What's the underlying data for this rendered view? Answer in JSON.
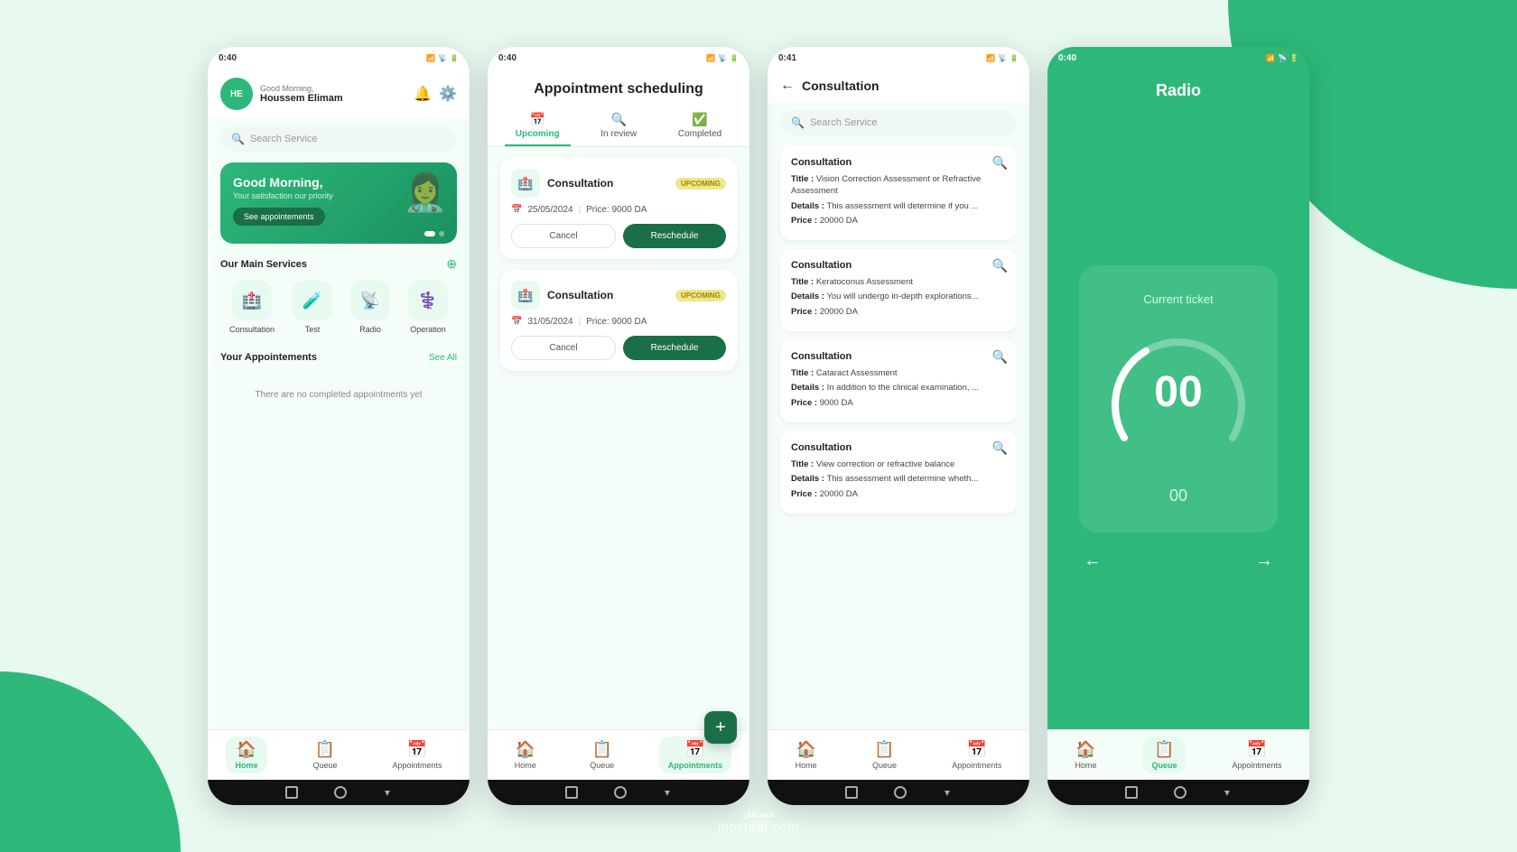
{
  "background": {
    "primary_color": "#e8f9f0",
    "accent_color": "#2db87a",
    "dark_accent": "#1a6e48"
  },
  "screen1": {
    "status_time": "0:40",
    "user_initials": "HE",
    "greeting_small": "Good Morning,",
    "user_name": "Houssem Elimam",
    "search_placeholder": "Search Service",
    "banner_title": "Good Morning,",
    "banner_subtitle": "Your satisfaction our priority",
    "banner_btn": "See appointements",
    "section_services": "Our Main Services",
    "section_appointments": "Your Appointements",
    "see_all": "See All",
    "no_appointments": "There are no completed appointments yet",
    "services": [
      {
        "label": "Consultation",
        "icon": "🏥"
      },
      {
        "label": "Test",
        "icon": "🧪"
      },
      {
        "label": "Radio",
        "icon": "📡"
      },
      {
        "label": "Operation",
        "icon": "⚕️"
      }
    ],
    "nav": [
      {
        "label": "Home",
        "icon": "🏠",
        "active": true
      },
      {
        "label": "Queue",
        "icon": "📋",
        "active": false
      },
      {
        "label": "Appointments",
        "icon": "📅",
        "active": false
      }
    ]
  },
  "screen2": {
    "status_time": "0:40",
    "title": "Appointment scheduling",
    "tabs": [
      {
        "label": "Upcoming",
        "icon": "📅",
        "active": true
      },
      {
        "label": "In review",
        "icon": "🔍",
        "active": false
      },
      {
        "label": "Completed",
        "icon": "✅",
        "active": false
      }
    ],
    "cards": [
      {
        "title": "Consultation",
        "badge": "UPCOMING",
        "date": "25/05/2024",
        "price": "Price: 9000 DA",
        "cancel_btn": "Cancel",
        "reschedule_btn": "Reschedule"
      },
      {
        "title": "Consultation",
        "badge": "UPCOMING",
        "date": "31/05/2024",
        "price": "Price: 9000 DA",
        "cancel_btn": "Cancel",
        "reschedule_btn": "Reschedule"
      }
    ],
    "fab_icon": "+",
    "nav": [
      {
        "label": "Home",
        "icon": "🏠",
        "active": false
      },
      {
        "label": "Queue",
        "icon": "📋",
        "active": false
      },
      {
        "label": "Appointments",
        "icon": "📅",
        "active": true
      }
    ]
  },
  "screen3": {
    "status_time": "0:41",
    "title": "Consultation",
    "search_placeholder": "Search Service",
    "cards": [
      {
        "title": "Consultation",
        "field_title_label": "Title :",
        "field_title_value": "Vision Correction Assessment or Refractive Assessment",
        "field_details_label": "Details :",
        "field_details_value": "This assessment will determine if you ...",
        "field_price_label": "Price :",
        "field_price_value": "20000 DA"
      },
      {
        "title": "Consultation",
        "field_title_label": "Title :",
        "field_title_value": "Keratoconus Assessment",
        "field_details_label": "Details :",
        "field_details_value": "You will undergo in-depth explorations...",
        "field_price_label": "Price :",
        "field_price_value": "20000 DA"
      },
      {
        "title": "Consultation",
        "field_title_label": "Title :",
        "field_title_value": "Cataract Assessment",
        "field_details_label": "Details :",
        "field_details_value": "In addition to the clinical examination, ...",
        "field_price_label": "Price :",
        "field_price_value": "9000 DA"
      },
      {
        "title": "Consultation",
        "field_title_label": "Title :",
        "field_title_value": "View correction or refractive balance",
        "field_details_label": "Details :",
        "field_details_value": "This assessment will determine wheth...",
        "field_price_label": "Price :",
        "field_price_value": "20000 DA"
      }
    ],
    "nav": [
      {
        "label": "Home",
        "icon": "🏠",
        "active": false
      },
      {
        "label": "Queue",
        "icon": "📋",
        "active": false
      },
      {
        "label": "Appointments",
        "icon": "📅",
        "active": false
      }
    ]
  },
  "screen4": {
    "status_time": "0:40",
    "title": "Radio",
    "ticket_label": "Current ticket",
    "ticket_number": "00",
    "sub_number": "00",
    "nav": [
      {
        "label": "Home",
        "icon": "🏠",
        "active": false
      },
      {
        "label": "Queue",
        "icon": "📋",
        "active": true
      },
      {
        "label": "Appointments",
        "icon": "📅",
        "active": false
      }
    ]
  },
  "watermark": {
    "arabic": "مستقل",
    "latin": "mostaql.com"
  }
}
